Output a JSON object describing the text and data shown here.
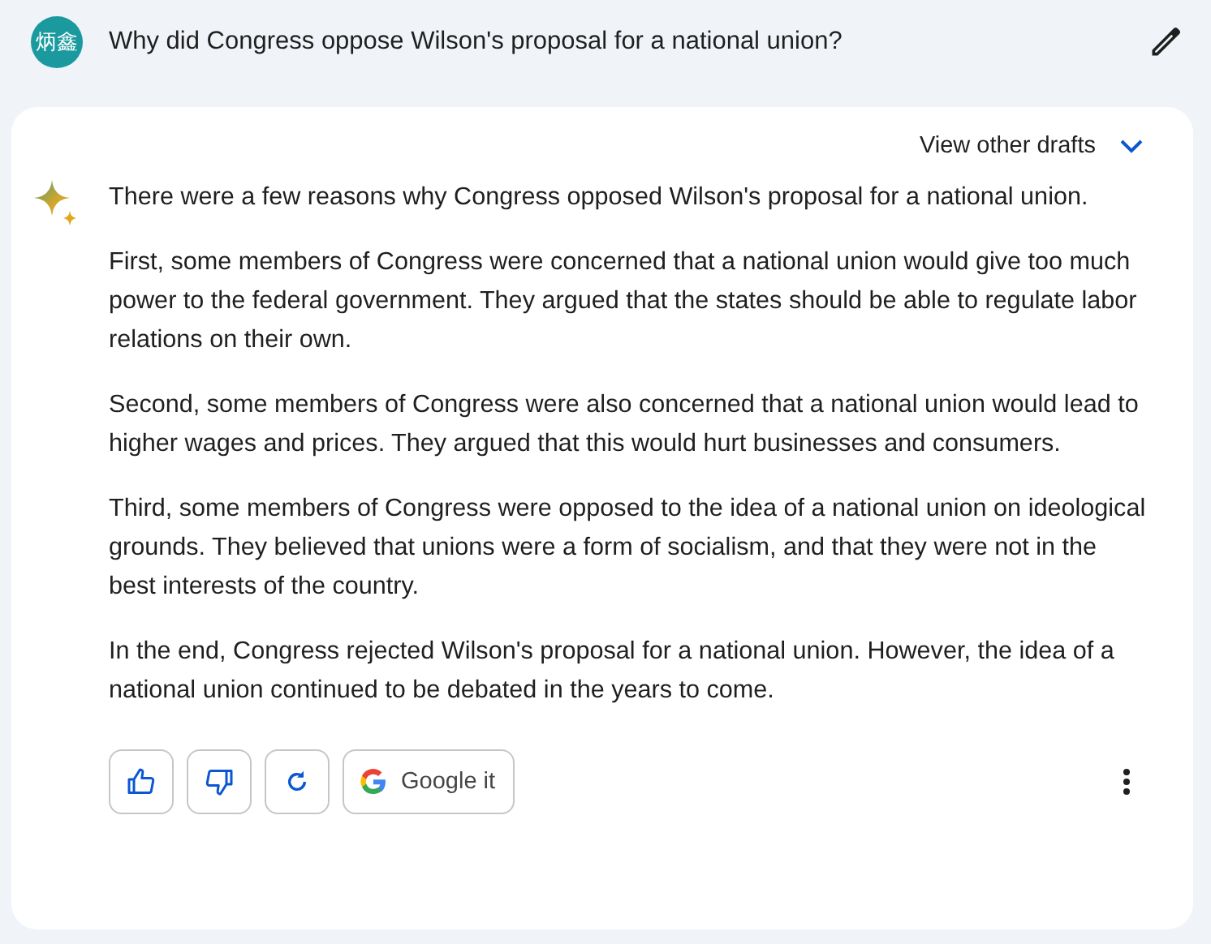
{
  "prompt": {
    "avatar": "炳鑫",
    "text": "Why did Congress oppose Wilson's proposal for a national union?"
  },
  "response": {
    "drafts_label": "View other drafts",
    "paragraphs": [
      "There were a few reasons why Congress opposed Wilson's proposal for a national union.",
      "First, some members of Congress were concerned that a national union would give too much power to the federal government. They argued that the states should be able to regulate labor relations on their own.",
      "Second, some members of Congress were also concerned that a national union would lead to higher wages and prices. They argued that this would hurt businesses and consumers.",
      "Third, some members of Congress were opposed to the idea of a national union on ideological grounds. They believed that unions were a form of socialism, and that they were not in the best interests of the country.",
      "In the end, Congress rejected Wilson's proposal for a national union. However, the idea of a national union continued to be debated in the years to come."
    ],
    "google_label": "Google it"
  }
}
